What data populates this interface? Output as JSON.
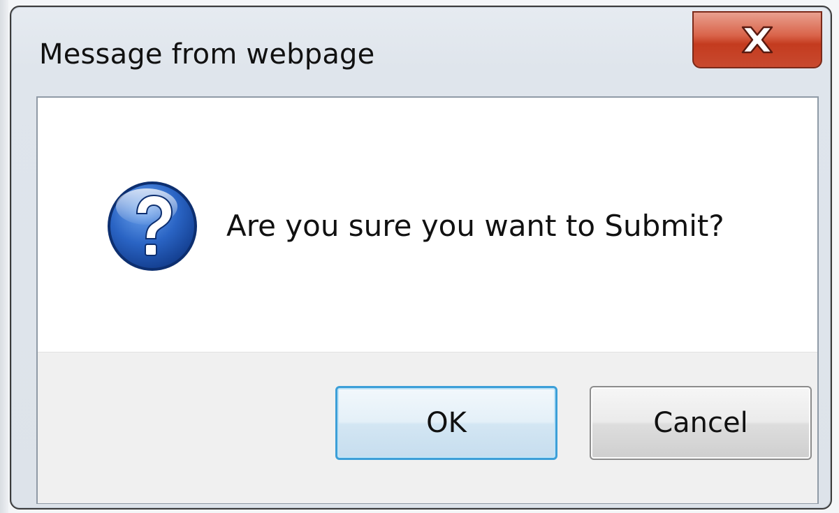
{
  "dialog": {
    "title": "Message from webpage",
    "message": "Are you sure you want to Submit?",
    "close_icon": "close-icon",
    "message_icon": "question-icon"
  },
  "buttons": {
    "ok_label": "OK",
    "cancel_label": "Cancel"
  },
  "colors": {
    "close_button": "#c84a2f",
    "ok_focus_border": "#3c9fd8",
    "icon_blue": "#1f5fb8",
    "button_bar": "#f0f0f0"
  }
}
